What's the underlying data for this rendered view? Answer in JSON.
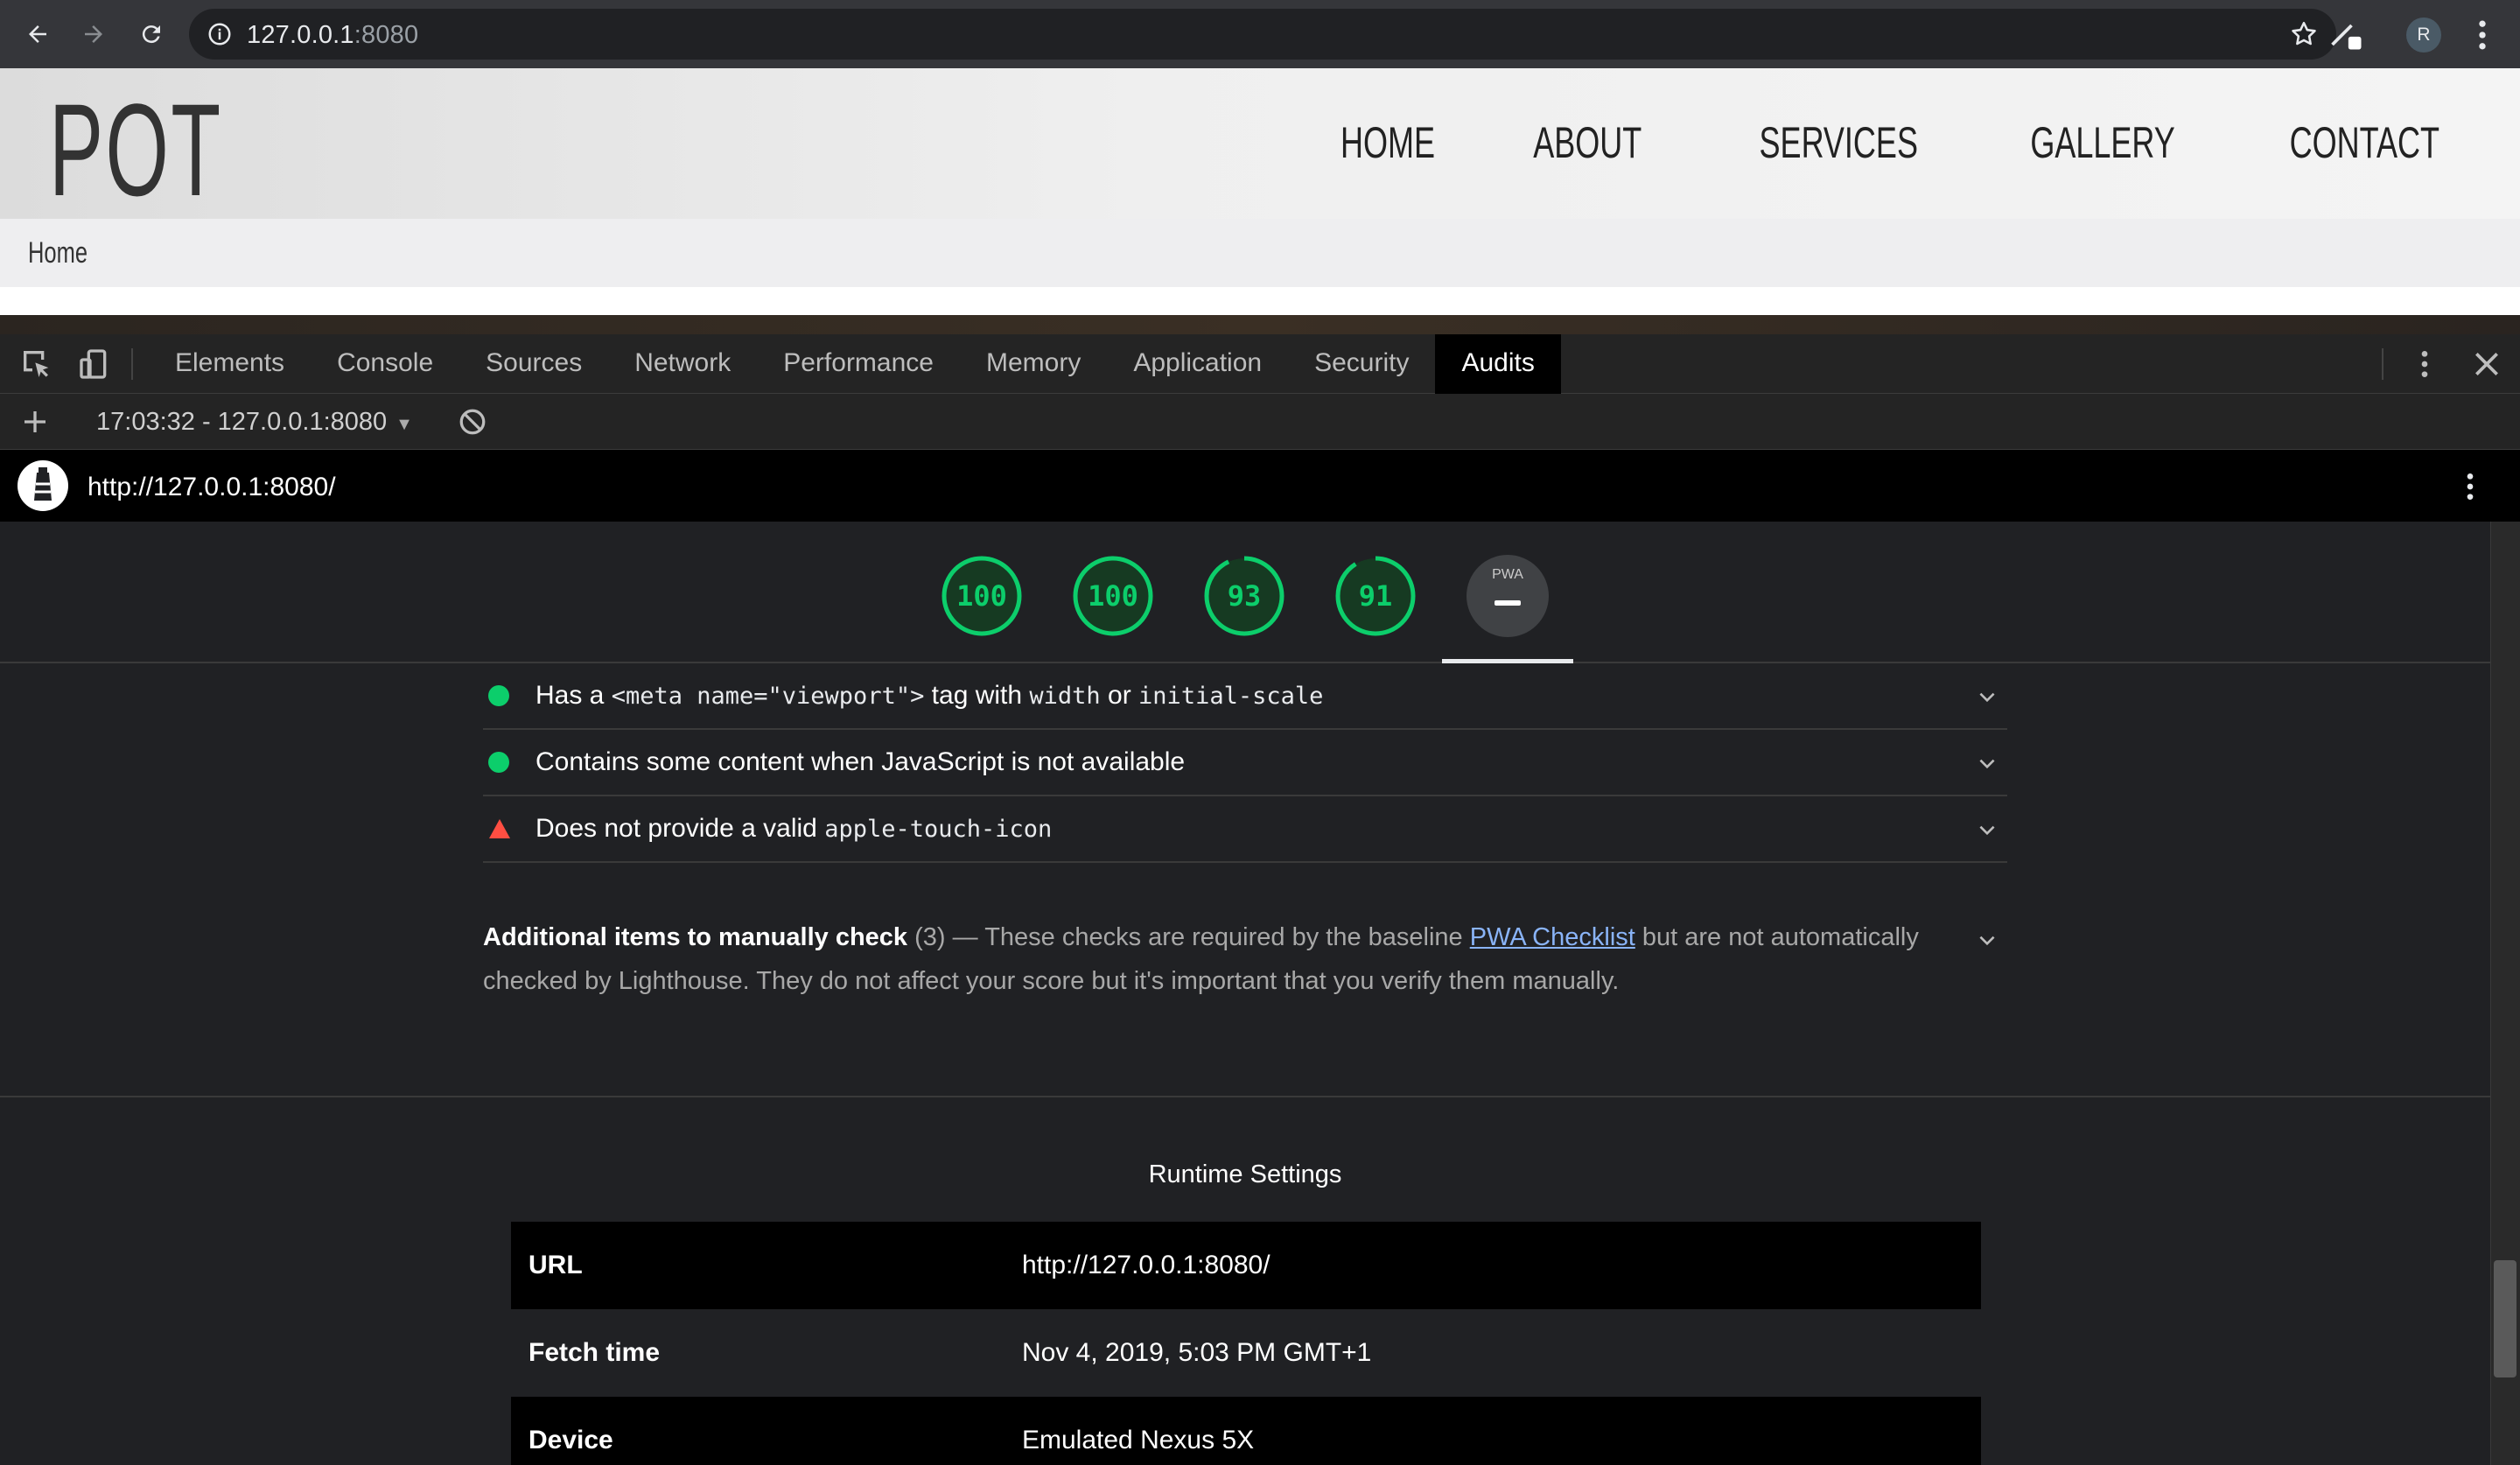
{
  "browser": {
    "url_host": "127.0.0.1",
    "url_port": ":8080",
    "profile_initial": "R"
  },
  "site": {
    "logo": "POT",
    "nav": [
      "HOME",
      "ABOUT",
      "SERVICES",
      "GALLERY",
      "CONTACT"
    ],
    "breadcrumb": "Home"
  },
  "devtools": {
    "tabs": [
      "Elements",
      "Console",
      "Sources",
      "Network",
      "Performance",
      "Memory",
      "Application",
      "Security",
      "Audits"
    ],
    "active_tab": "Audits",
    "report_select": "17:03:32 - 127.0.0.1:8080"
  },
  "lighthouse": {
    "url": "http://127.0.0.1:8080/",
    "scores": [
      "100",
      "100",
      "93",
      "91"
    ],
    "score_values": [
      100,
      100,
      93,
      91
    ],
    "pwa_label": "PWA",
    "accent_pass": "#0cce6b",
    "accent_fail": "#ff4e42",
    "audits": [
      {
        "status": "pass",
        "prefix": "Has a ",
        "code1": "<meta name=\"viewport\">",
        "mid": " tag with ",
        "code2": "width",
        "mid2": " or ",
        "code3": "initial-scale"
      },
      {
        "status": "pass",
        "text": "Contains some content when JavaScript is not available"
      },
      {
        "status": "fail",
        "prefix": "Does not provide a valid ",
        "code1": "apple-touch-icon"
      }
    ],
    "manual": {
      "title": "Additional items to manually check",
      "count": "(3)",
      "dash": "—",
      "desc_before": "These checks are required by the baseline ",
      "link": "PWA Checklist",
      "desc_after": " but are not automatically checked by Lighthouse. They do not affect your score but it's important that you verify them manually."
    },
    "runtime": {
      "title": "Runtime Settings",
      "rows": [
        {
          "key": "URL",
          "value": "http://127.0.0.1:8080/"
        },
        {
          "key": "Fetch time",
          "value": "Nov 4, 2019, 5:03 PM GMT+1"
        },
        {
          "key": "Device",
          "value": "Emulated Nexus 5X"
        }
      ]
    }
  },
  "icons": [
    "back-icon",
    "forward-icon",
    "reload-icon",
    "info-icon",
    "star-icon",
    "extension-icon",
    "kebab-menu-icon",
    "inspect-icon",
    "device-toggle-icon",
    "close-icon",
    "plus-icon",
    "clear-icon",
    "lighthouse-logo-icon",
    "chevron-down-icon",
    "pass-icon",
    "fail-icon"
  ]
}
